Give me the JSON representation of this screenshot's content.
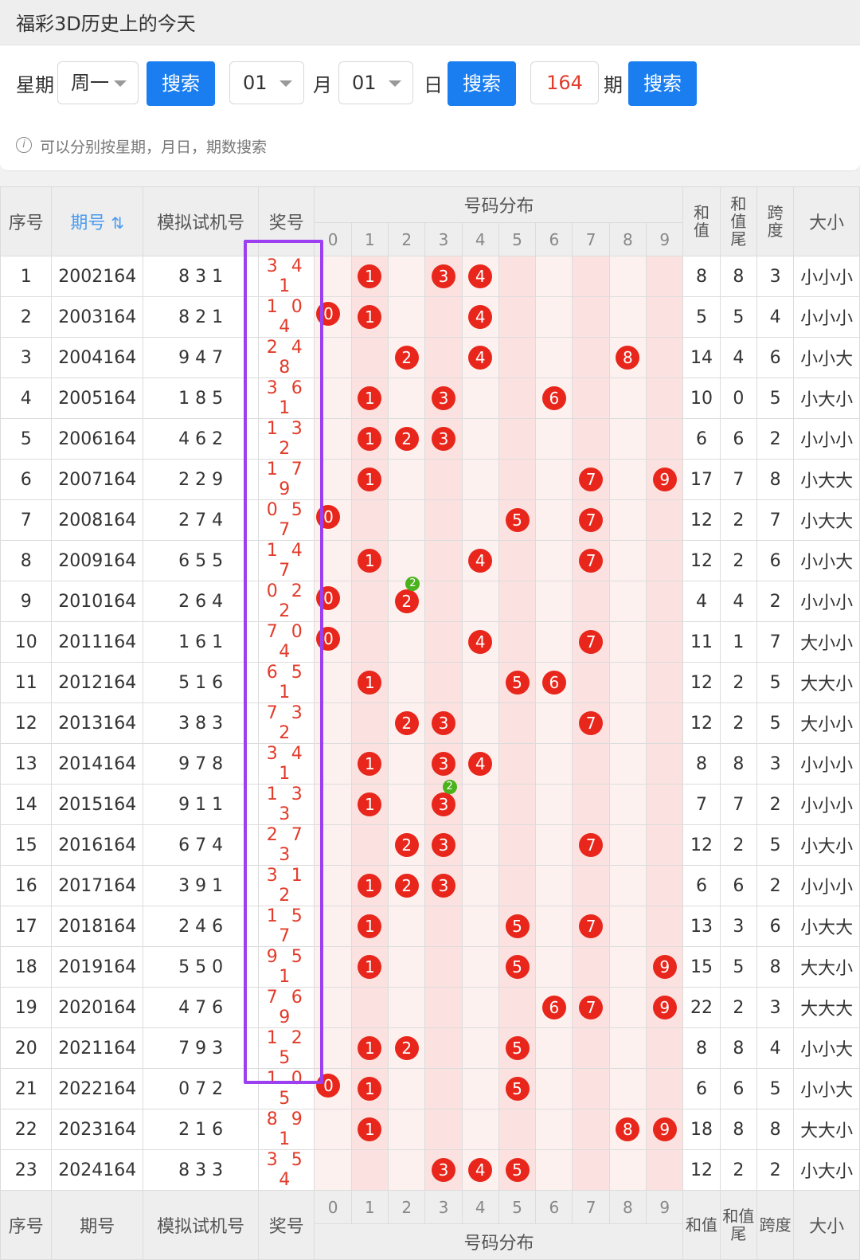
{
  "title": "福彩3D历史上的今天",
  "search": {
    "weekday_label": "星期",
    "weekday_value": "周一",
    "search_label": "搜索",
    "month_value": "01",
    "month_label": "月",
    "day_value": "01",
    "day_label": "日",
    "period_value": "164",
    "period_label": "期"
  },
  "hint": "可以分别按星期，月日，期数搜索",
  "header": {
    "index": "序号",
    "period": "期号",
    "sort_icon": "sort-icon",
    "sim": "模拟试机号",
    "prize": "奖号",
    "dist": "号码分布",
    "digits": [
      "0",
      "1",
      "2",
      "3",
      "4",
      "5",
      "6",
      "7",
      "8",
      "9"
    ],
    "sum": "和值",
    "sum_tail": "和值尾",
    "span": "跨度",
    "size": "大小"
  },
  "rows": [
    {
      "i": "1",
      "p": "2002164",
      "s": "8 3 1",
      "w": "341",
      "sum": "8",
      "tail": "8",
      "span": "3",
      "size": "小小小"
    },
    {
      "i": "2",
      "p": "2003164",
      "s": "8 2 1",
      "w": "104",
      "sum": "5",
      "tail": "5",
      "span": "4",
      "size": "小小小"
    },
    {
      "i": "3",
      "p": "2004164",
      "s": "9 4 7",
      "w": "248",
      "sum": "14",
      "tail": "4",
      "span": "6",
      "size": "小小大"
    },
    {
      "i": "4",
      "p": "2005164",
      "s": "1 8 5",
      "w": "361",
      "sum": "10",
      "tail": "0",
      "span": "5",
      "size": "小大小"
    },
    {
      "i": "5",
      "p": "2006164",
      "s": "4 6 2",
      "w": "132",
      "sum": "6",
      "tail": "6",
      "span": "2",
      "size": "小小小"
    },
    {
      "i": "6",
      "p": "2007164",
      "s": "2 2 9",
      "w": "179",
      "sum": "17",
      "tail": "7",
      "span": "8",
      "size": "小大大"
    },
    {
      "i": "7",
      "p": "2008164",
      "s": "2 7 4",
      "w": "057",
      "sum": "12",
      "tail": "2",
      "span": "7",
      "size": "小大大"
    },
    {
      "i": "8",
      "p": "2009164",
      "s": "6 5 5",
      "w": "147",
      "sum": "12",
      "tail": "2",
      "span": "6",
      "size": "小小大"
    },
    {
      "i": "9",
      "p": "2010164",
      "s": "2 6 4",
      "w": "022",
      "sum": "4",
      "tail": "4",
      "span": "2",
      "size": "小小小"
    },
    {
      "i": "10",
      "p": "2011164",
      "s": "1 6 1",
      "w": "704",
      "sum": "11",
      "tail": "1",
      "span": "7",
      "size": "大小小"
    },
    {
      "i": "11",
      "p": "2012164",
      "s": "5 1 6",
      "w": "651",
      "sum": "12",
      "tail": "2",
      "span": "5",
      "size": "大大小"
    },
    {
      "i": "12",
      "p": "2013164",
      "s": "3 8 3",
      "w": "732",
      "sum": "12",
      "tail": "2",
      "span": "5",
      "size": "大小小"
    },
    {
      "i": "13",
      "p": "2014164",
      "s": "9 7 8",
      "w": "341",
      "sum": "8",
      "tail": "8",
      "span": "3",
      "size": "小小小"
    },
    {
      "i": "14",
      "p": "2015164",
      "s": "9 1 1",
      "w": "133",
      "sum": "7",
      "tail": "7",
      "span": "2",
      "size": "小小小"
    },
    {
      "i": "15",
      "p": "2016164",
      "s": "6 7 4",
      "w": "273",
      "sum": "12",
      "tail": "2",
      "span": "5",
      "size": "小大小"
    },
    {
      "i": "16",
      "p": "2017164",
      "s": "3 9 1",
      "w": "312",
      "sum": "6",
      "tail": "6",
      "span": "2",
      "size": "小小小"
    },
    {
      "i": "17",
      "p": "2018164",
      "s": "2 4 6",
      "w": "157",
      "sum": "13",
      "tail": "3",
      "span": "6",
      "size": "小大大"
    },
    {
      "i": "18",
      "p": "2019164",
      "s": "5 5 0",
      "w": "951",
      "sum": "15",
      "tail": "5",
      "span": "8",
      "size": "大大小"
    },
    {
      "i": "19",
      "p": "2020164",
      "s": "4 7 6",
      "w": "769",
      "sum": "22",
      "tail": "2",
      "span": "3",
      "size": "大大大"
    },
    {
      "i": "20",
      "p": "2021164",
      "s": "7 9 3",
      "w": "125",
      "sum": "8",
      "tail": "8",
      "span": "4",
      "size": "小小大"
    },
    {
      "i": "21",
      "p": "2022164",
      "s": "0 7 2",
      "w": "105",
      "sum": "6",
      "tail": "6",
      "span": "5",
      "size": "小小大"
    },
    {
      "i": "22",
      "p": "2023164",
      "s": "2 1 6",
      "w": "891",
      "sum": "18",
      "tail": "8",
      "span": "8",
      "size": "大大小"
    },
    {
      "i": "23",
      "p": "2024164",
      "s": "8 3 3",
      "w": "354",
      "sum": "12",
      "tail": "2",
      "span": "2",
      "size": "小大小"
    }
  ],
  "colors": {
    "accent": "#1a7ef0",
    "ball": "#e8261b",
    "repeat_tag": "#4ab21b",
    "highlight": "#9c3ff0",
    "prize_text": "#e23b2a"
  }
}
